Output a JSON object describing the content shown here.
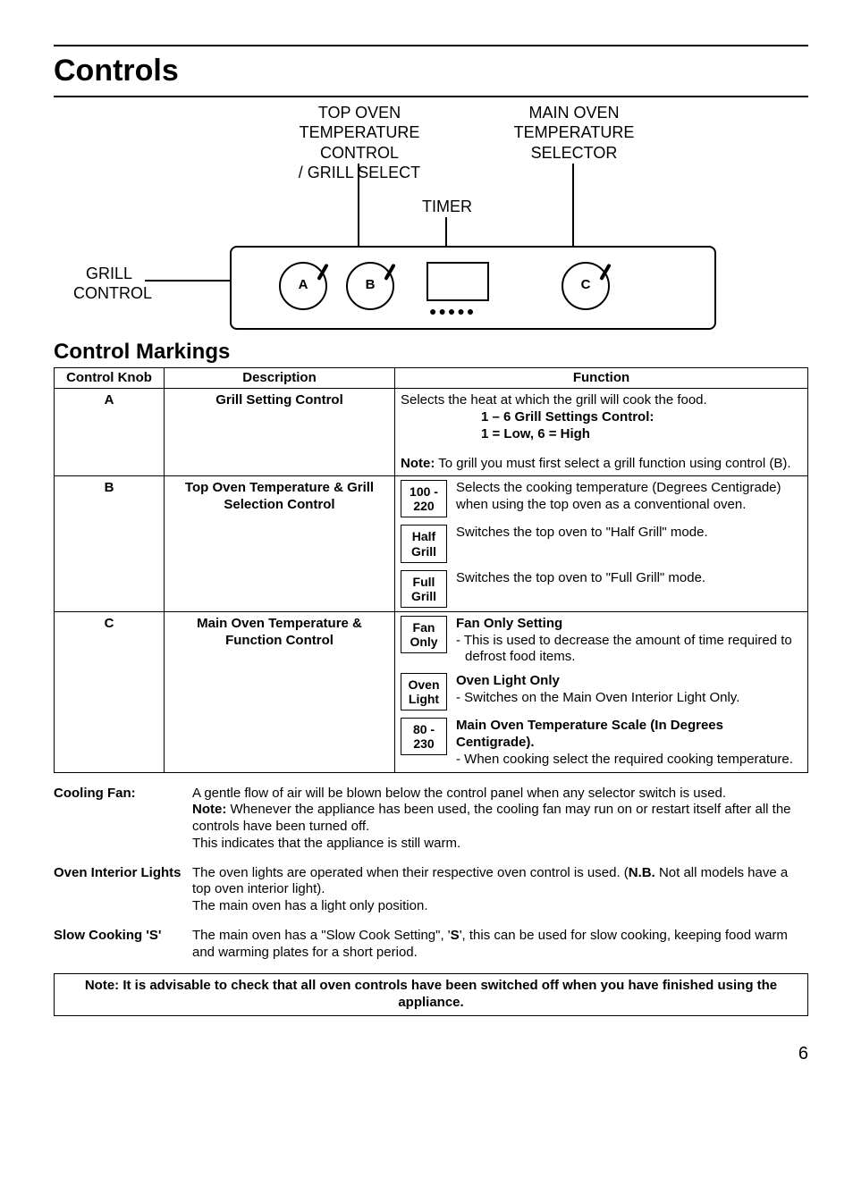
{
  "title": "Controls",
  "diagram": {
    "top_oven_label": "TOP OVEN\nTEMPERATURE CONTROL\n/ GRILL SELECT",
    "main_oven_label": "MAIN OVEN\nTEMPERATURE\nSELECTOR",
    "timer_label": "TIMER",
    "grill_control_label": "GRILL\nCONTROL",
    "knobA": "A",
    "knobB": "B",
    "knobC": "C"
  },
  "section_heading": "Control Markings",
  "table": {
    "headers": {
      "knob": "Control Knob",
      "desc": "Description",
      "func": "Function"
    },
    "rowA": {
      "knob": "A",
      "desc": "Grill Setting Control",
      "intro": "Selects the heat at which the grill will cook the food.",
      "line1": "1 – 6 Grill Settings Control:",
      "line2": "1 = Low, 6 = High",
      "note_label": "Note:",
      "note_text": " To grill you must first select a grill function using control (B)."
    },
    "rowB": {
      "knob": "B",
      "desc": "Top Oven Temperature & Grill Selection Control",
      "tag1": "100 - 220",
      "text1": "Selects the cooking temperature (Degrees Centigrade) when using the top oven as a conventional oven.",
      "tag2": "Half Grill",
      "text2": "Switches the top oven to \"Half Grill\" mode.",
      "tag3": "Full Grill",
      "text3": "Switches the top oven to \"Full Grill\" mode."
    },
    "rowC": {
      "knob": "C",
      "desc": "Main Oven Temperature & Function Control",
      "tag1": "Fan Only",
      "head1": "Fan Only Setting",
      "text1": "-  This is used to decrease the amount of time required to defrost food items.",
      "tag2": "Oven Light",
      "head2": "Oven Light Only",
      "text2": "-  Switches on the Main Oven Interior Light Only.",
      "tag3": "80 - 230",
      "head3": "Main Oven Temperature Scale (In Degrees Centigrade).",
      "text3": "-  When cooking select the required cooking temperature."
    }
  },
  "notes": {
    "cooling_fan": {
      "label": "Cooling Fan:",
      "text1": "A gentle flow of air will be blown below the control panel when any selector switch is used.",
      "note_label": "Note:",
      "text2": " Whenever the appliance has been used, the cooling fan may run on or restart itself after all the controls have been turned off.",
      "text3": "This indicates that the appliance is still warm."
    },
    "oven_interior": {
      "label": "Oven Interior Lights",
      "text1a": "The oven lights are operated when their respective oven control is used. (",
      "nb": "N.B.",
      "text1b": " Not all models have a top oven interior light).",
      "text2": "The main oven has a light only position."
    },
    "slow_cooking": {
      "label": "Slow Cooking 'S'",
      "text_a": "The main oven  has a \"Slow Cook Setting\", '",
      "s": "S",
      "text_b": "', this can be used for slow cooking, keeping food warm and warming plates for a short period."
    }
  },
  "final_note": "Note: It is advisable to check that all oven controls have been switched off when you have finished using the appliance.",
  "page_number": "6"
}
